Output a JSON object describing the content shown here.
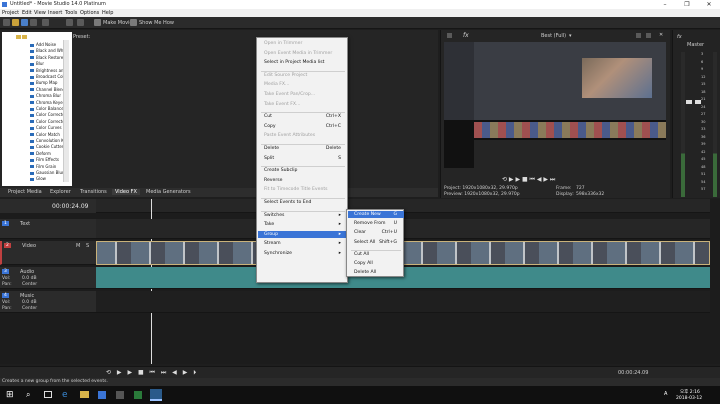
{
  "window": {
    "title": "Untitled* - Movie Studio 14.0 Platinum"
  },
  "menu": [
    "Project",
    "Edit",
    "View",
    "Insert",
    "Tools",
    "Options",
    "Help"
  ],
  "toolbar": {
    "make_movie": "Make Movie",
    "show_me_how": "Show Me How"
  },
  "fx_panel": {
    "preset_label": "Preset:",
    "items": [
      "Add Noise",
      "Black and White",
      "Black Restore",
      "Blur",
      "Brightness and",
      "Broadcast Color",
      "Bump Map",
      "Channel Blend",
      "Chroma Blur",
      "Chroma Keyer",
      "Color Balance",
      "Color Corrector",
      "Color Corrector",
      "Color Curves",
      "Color Match",
      "Convolution Ker",
      "Cookie Cutter",
      "Deform",
      "Film Effects",
      "Film Grain",
      "Gaussian Blur",
      "Glow"
    ]
  },
  "tabs": [
    "Project Media",
    "Explorer",
    "Transitions",
    "Video FX",
    "Media Generators"
  ],
  "preview": {
    "quality": "Best (Full)",
    "project": "Project: 1920x1080x32, 29.970p",
    "preview_res": "Preview: 1920x1080x32, 29.970p",
    "frame": "Frame:",
    "frame_value": "727",
    "display": "Display:",
    "display_value": "598x336x32"
  },
  "master": {
    "label": "Master",
    "ticks": [
      "3",
      "6",
      "9",
      "12",
      "15",
      "18",
      "21",
      "24",
      "27",
      "30",
      "33",
      "36",
      "39",
      "42",
      "45",
      "48",
      "51",
      "54",
      "57"
    ]
  },
  "timeline": {
    "timecode": "00:00:24.09",
    "tracks": [
      {
        "num": "1",
        "name": "Text",
        "type": "text"
      },
      {
        "num": "2",
        "name": "Video",
        "type": "video"
      },
      {
        "num": "3",
        "name": "Audio",
        "type": "audio",
        "vol": "Vol:",
        "vol_value": "0.0 dB",
        "pan": "Pan:",
        "pan_value": "Center"
      },
      {
        "num": "4",
        "name": "Music",
        "type": "music",
        "vol": "Vol:",
        "vol_value": "0.0 dB",
        "pan": "Pan:",
        "pan_value": "Center"
      }
    ],
    "rate_label": "Rate:",
    "rate_value": "0.00",
    "end_timecode": "00:00:24.09"
  },
  "context_menu": {
    "items": [
      {
        "label": "Open in Trimmer",
        "shortcut": "",
        "disabled": true
      },
      {
        "label": "Open Event Media in Trimmer",
        "shortcut": "",
        "disabled": true
      },
      {
        "label": "Select in Project Media list",
        "shortcut": "",
        "disabled": false
      },
      {
        "label": "Edit Source Project",
        "shortcut": "",
        "disabled": true
      },
      {
        "label": "Media FX...",
        "shortcut": "",
        "disabled": true
      },
      {
        "label": "Take Event Pan/Crop...",
        "shortcut": "",
        "disabled": true
      },
      {
        "label": "Take Event FX...",
        "shortcut": "",
        "disabled": true
      },
      {
        "label": "Cut",
        "shortcut": "Ctrl+X",
        "disabled": false
      },
      {
        "label": "Copy",
        "shortcut": "Ctrl+C",
        "disabled": false
      },
      {
        "label": "Paste Event Attributes",
        "shortcut": "",
        "disabled": true
      },
      {
        "label": "Delete",
        "shortcut": "Delete",
        "disabled": false
      },
      {
        "label": "Split",
        "shortcut": "S",
        "disabled": false
      },
      {
        "label": "Create Subclip",
        "shortcut": "",
        "disabled": false
      },
      {
        "label": "Reverse",
        "shortcut": "",
        "disabled": false
      },
      {
        "label": "Fit to Timecode Title Events",
        "shortcut": "",
        "disabled": true
      },
      {
        "label": "Select Events to End",
        "shortcut": "",
        "disabled": false
      },
      {
        "label": "Switches",
        "shortcut": "",
        "disabled": false
      },
      {
        "label": "Take",
        "shortcut": "",
        "disabled": false
      },
      {
        "label": "Group",
        "shortcut": "",
        "disabled": false
      },
      {
        "label": "Stream",
        "shortcut": "",
        "disabled": false
      },
      {
        "label": "Synchronize",
        "shortcut": "",
        "disabled": false
      }
    ]
  },
  "group_submenu": {
    "items": [
      {
        "label": "Create New",
        "shortcut": "G"
      },
      {
        "label": "Remove From",
        "shortcut": "U"
      },
      {
        "label": "Clear",
        "shortcut": "Ctrl+U"
      },
      {
        "label": "Select All",
        "shortcut": "Shift+G"
      },
      {
        "label": "Cut All",
        "shortcut": ""
      },
      {
        "label": "Copy All",
        "shortcut": ""
      },
      {
        "label": "Delete All",
        "shortcut": ""
      }
    ]
  },
  "status": {
    "text": "Creates a new group from the selected events."
  },
  "taskbar": {
    "time": "오후 2:16",
    "date": "2018-03-12",
    "lang": "A"
  }
}
